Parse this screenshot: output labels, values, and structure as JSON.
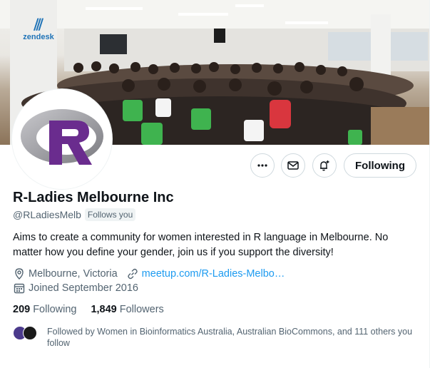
{
  "banner": {
    "sponsor_logo_text": "zendesk"
  },
  "profile": {
    "display_name": "R-Ladies Melbourne Inc",
    "handle": "@RLadiesMelb",
    "follows_you_badge": "Follows you",
    "bio": "Aims to create a community for women interested in R language in Melbourne. No matter how you define your gender, join us if you support the diversity!",
    "location": "Melbourne, Victoria",
    "website": "meetup.com/R-Ladies-Melbo…",
    "joined": "Joined September 2016"
  },
  "stats": {
    "following_count": "209",
    "following_label": "Following",
    "followers_count": "1,849",
    "followers_label": "Followers"
  },
  "actions": {
    "follow_button_label": "Following"
  },
  "followed_by": {
    "text": "Followed by Women in Bioinformatics Australia, Australian BioCommons, and 111 others you follow"
  },
  "icons": {
    "more": "more-horizontal-icon",
    "message": "envelope-icon",
    "notify": "bell-plus-icon",
    "location": "location-pin-icon",
    "link": "link-icon",
    "calendar": "calendar-icon"
  },
  "colors": {
    "accent": "#1d9bf0",
    "secondary_text": "#536471",
    "primary_text": "#0f1419",
    "r_logo_purple": "#6a2c8e"
  }
}
